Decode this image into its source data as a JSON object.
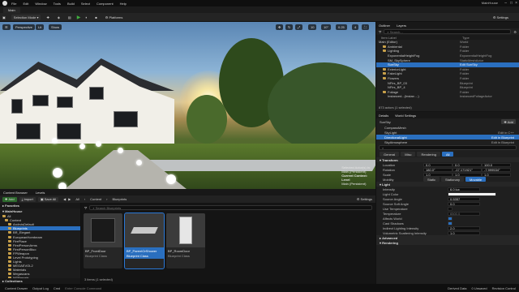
{
  "menu": {
    "items": [
      "File",
      "Edit",
      "Window",
      "Tools",
      "Build",
      "Select",
      "Component",
      "Help"
    ],
    "project": "MainHouse"
  },
  "tabs": {
    "level": "Main"
  },
  "toolbar": {
    "mode": "Selection Mode",
    "platforms": "Platforms",
    "settings": "Settings"
  },
  "viewport": {
    "buttons": [
      "Perspective",
      "Lit",
      "Show"
    ],
    "info": {
      "line1": "Selected Actor(s) in:",
      "line2": "Main (Persistent)",
      "line3": "Current Context:",
      "line4": "Level",
      "line5": "Main (Persistent)"
    }
  },
  "outliner": {
    "tabs": [
      "Outliner",
      "Layers"
    ],
    "search_placeholder": "Search...",
    "columns": {
      "label": "Item Label",
      "type": "Type"
    },
    "rows": [
      {
        "label": "Main (Editor)",
        "type": "World"
      },
      {
        "label": "Ambiental",
        "type": "Folder"
      },
      {
        "label": "Lighting",
        "type": "Folder"
      },
      {
        "label": "ExponentialHeightFog",
        "type": "ExponentialHeightFog"
      },
      {
        "label": "SM_SkySphere",
        "type": "StaticMeshActor"
      },
      {
        "label": "SunSky",
        "type": "Edit SunSky"
      },
      {
        "label": "ExteriorLight",
        "type": "Folder"
      },
      {
        "label": "FakeLight",
        "type": "Folder"
      },
      {
        "label": "Flowers",
        "type": "Folder"
      },
      {
        "label": "NFlrs_BP_03",
        "type": "Blueprint"
      },
      {
        "label": "NFlrs_BP_4",
        "type": "Blueprint"
      },
      {
        "label": "Foliage",
        "type": "Folder"
      },
      {
        "label": "Instanced...(Instan ...)",
        "type": "InstancedFoliageActor"
      }
    ],
    "footer": "873 actors (1 selected)"
  },
  "details": {
    "tabs": [
      "Details",
      "World Settings"
    ],
    "actor_name": "SunSky",
    "add_label": "Add",
    "components": [
      {
        "label": "CompassMesh",
        "edit": ""
      },
      {
        "label": "SkyLight",
        "edit": "Edit in C++"
      },
      {
        "label": "DirectionalLight",
        "edit": "Edit in Blueprint"
      },
      {
        "label": "SkyAtmosphere",
        "edit": "Edit in Blueprint"
      }
    ],
    "filters": [
      "General",
      "Misc",
      "Rendering",
      "All"
    ],
    "transform": {
      "title": "Transform",
      "location": {
        "label": "Location",
        "x": "0.0",
        "y": "0.0",
        "z": "100.0"
      },
      "rotation": {
        "label": "Rotation",
        "x": "180.0°",
        "y": "-17.171921°",
        "z": "-7.999534°"
      },
      "scale": {
        "label": "Scale",
        "x": "1.0",
        "y": "1.0",
        "z": "1.0"
      },
      "mobility": {
        "label": "Mobility",
        "options": [
          "Static",
          "Stationary",
          "Movable"
        ],
        "selected": "Movable"
      }
    },
    "light": {
      "title": "Light",
      "props": [
        {
          "label": "Intensity",
          "value": "6.0 lux"
        },
        {
          "label": "Light Color",
          "value": ""
        },
        {
          "label": "Source Angle",
          "value": "0.5357"
        },
        {
          "label": "Source Soft Angle",
          "value": "0.0"
        },
        {
          "label": "Use Temperature",
          "value": ""
        },
        {
          "label": "Temperature",
          "value": "6500.0"
        },
        {
          "label": "Affects World",
          "value": ""
        },
        {
          "label": "Cast Shadows",
          "value": ""
        },
        {
          "label": "Indirect Lighting Intensity",
          "value": "2.0"
        },
        {
          "label": "Volumetric Scattering Intensity",
          "value": "1.0"
        }
      ]
    },
    "sections": [
      "Advanced",
      "Rendering"
    ]
  },
  "content_browser": {
    "tabs": [
      "Content Browser",
      "Levels"
    ],
    "buttons": {
      "add": "Add",
      "import": "Import",
      "save_all": "Save All"
    },
    "breadcrumb": [
      "All",
      "Content",
      "Blueprints"
    ],
    "settings": "Settings",
    "favorites": "Favorites",
    "project": "MainHouse",
    "tree": [
      "All",
      "Content",
      "ArchvisDefault",
      "Blueprints",
      "BR_Elegant",
      "EuropeanHornbeam",
      "FirePlace",
      "FirstPersonArms",
      "FirstPersonBluo",
      "FPWeapon",
      "Level Prototyping",
      "Lights",
      "MEGAEVOL2",
      "Materials",
      "Megascans",
      "MSPresets"
    ],
    "collections": "Collections",
    "search_placeholder": "Search Blueprints",
    "assets": [
      {
        "label": "BP_FrontDoor",
        "kind": "Blueprint Class"
      },
      {
        "label": "BP_ParentOrShower",
        "kind": "Blueprint Class"
      },
      {
        "label": "BP_RoomDoor",
        "kind": "Blueprint Class"
      }
    ],
    "count": "3 items (1 selected)"
  },
  "statusbar": {
    "items": [
      "Content Drawer",
      "Output Log",
      "Cmd",
      "Enter Console Command",
      "Derived Data",
      "0 Unsaved",
      "Revision Control"
    ]
  },
  "colors": {
    "accent": "#2a6fbf",
    "play": "#3fb03f",
    "folder": "#c9a14a"
  }
}
